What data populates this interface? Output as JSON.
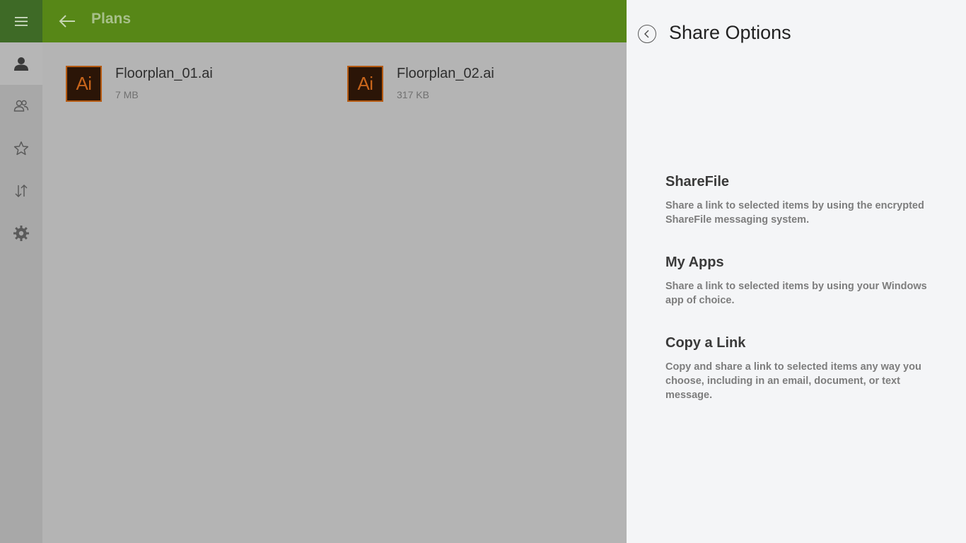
{
  "header": {
    "title": "Plans"
  },
  "nav": {
    "items": [
      {
        "icon": "hamburger-menu-icon"
      },
      {
        "icon": "person-icon"
      },
      {
        "icon": "people-icon"
      },
      {
        "icon": "star-icon"
      },
      {
        "icon": "transfer-arrows-icon"
      },
      {
        "icon": "gear-icon"
      }
    ]
  },
  "files": [
    {
      "name": "Floorplan_01.ai",
      "size": "7 MB",
      "icon_text": "Ai"
    },
    {
      "name": "Floorplan_02.ai",
      "size": "317 KB",
      "icon_text": "Ai"
    }
  ],
  "share_panel": {
    "title": "Share Options",
    "options": [
      {
        "title": "ShareFile",
        "description": "Share a link to selected items by using the encrypted ShareFile messaging system."
      },
      {
        "title": "My Apps",
        "description": "Share a link to selected items by using your Windows app of choice."
      },
      {
        "title": "Copy a Link",
        "description": "Copy and share a link to selected items any way you choose, including in an email, document, or text message."
      }
    ]
  },
  "colors": {
    "header": "#578717",
    "menu_button": "#3e6a26",
    "ai_icon_bg": "#2b1507",
    "ai_icon_fg": "#c8651b"
  }
}
